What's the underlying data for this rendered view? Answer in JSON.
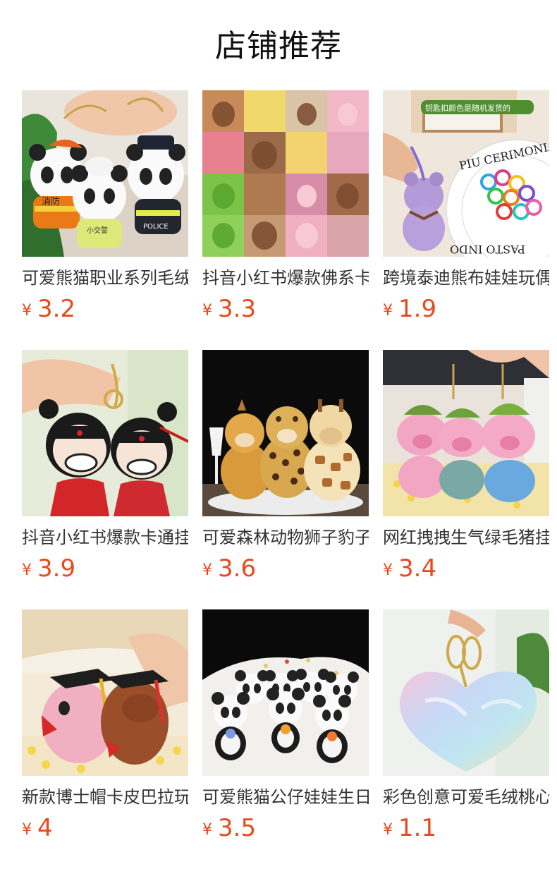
{
  "section": {
    "title": "店铺推荐"
  },
  "colors": {
    "price": "#e8491d",
    "text": "#333333"
  },
  "currency_symbol": "¥",
  "products": [
    {
      "name": "可爱熊猫职业系列毛绒",
      "price": "3.2",
      "image": "panda-uniform-keychains",
      "image_text": [
        "消防",
        "小交警",
        "POLICE"
      ]
    },
    {
      "name": "抖音小红书爆款佛系卡",
      "price": "3.3",
      "image": "capybara-collage"
    },
    {
      "name": "跨境泰迪熊布娃娃玩偶",
      "price": "1.9",
      "image": "purple-teddy-and-rings",
      "image_text": [
        "钥匙扣颜色是随机发货的",
        "PIU CERIMONIALE",
        "PASTO INDO"
      ]
    },
    {
      "name": "抖音小红书爆款卡通挂",
      "price": "3.9",
      "image": "opera-doll-keychains"
    },
    {
      "name": "可爱森林动物狮子豹子",
      "price": "3.6",
      "image": "forest-animal-plushies"
    },
    {
      "name": "网红拽拽生气绿毛猪挂",
      "price": "3.4",
      "image": "green-hair-pig-keychains"
    },
    {
      "name": "新款博士帽卡皮巴拉玩",
      "price": "4",
      "image": "graduation-cap-plush"
    },
    {
      "name": "可爱熊猫公仔娃娃生日",
      "price": "3.5",
      "image": "panda-dolls-with-flowers"
    },
    {
      "name": "彩色创意可爱毛绒桃心",
      "price": "1.1",
      "image": "rainbow-fur-heart"
    }
  ]
}
